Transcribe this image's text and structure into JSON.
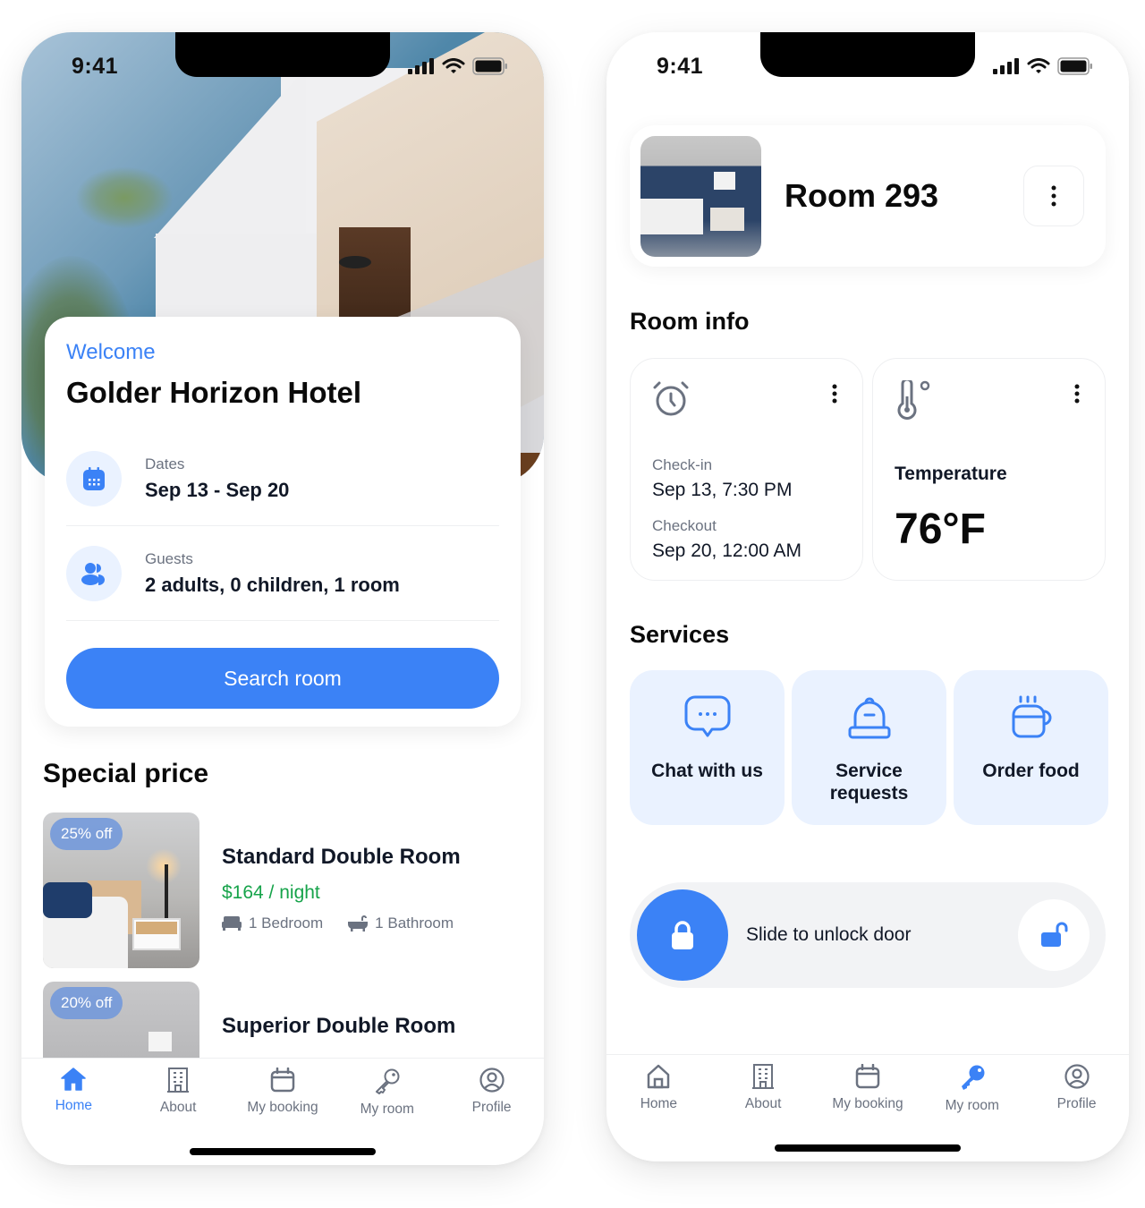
{
  "status_bar": {
    "time": "9:41"
  },
  "home_screen": {
    "welcome_label": "Welcome",
    "hotel_name": "Golder Horizon Hotel",
    "dates": {
      "label": "Dates",
      "value": "Sep 13 - Sep 20",
      "icon": "calendar-icon"
    },
    "guests": {
      "label": "Guests",
      "value": "2 adults, 0 children, 1 room",
      "icon": "users-icon"
    },
    "search_button": "Search room",
    "special_price_title": "Special price",
    "rooms": [
      {
        "badge": "25% off",
        "name": "Standard Double Room",
        "price": "$164 / night",
        "bedrooms": "1 Bedroom",
        "bathrooms": "1 Bathroom"
      },
      {
        "badge": "20% off",
        "name": "Superior Double Room"
      }
    ],
    "active_tab": "Home"
  },
  "room_screen": {
    "room_title": "Room 293",
    "room_info_title": "Room info",
    "checkin": {
      "label": "Check-in",
      "value": "Sep 13, 7:30 PM"
    },
    "checkout": {
      "label": "Checkout",
      "value": "Sep 20, 12:00 AM"
    },
    "temperature": {
      "label": "Temperature",
      "value": "76°F"
    },
    "services_title": "Services",
    "services": [
      {
        "label": "Chat with us",
        "icon": "chat-bubble-icon"
      },
      {
        "label": "Service requests",
        "icon": "service-bell-icon"
      },
      {
        "label": "Order food",
        "icon": "coffee-cup-icon"
      }
    ],
    "slider_text": "Slide to unlock door",
    "active_tab": "My room"
  },
  "tabs": [
    {
      "label": "Home",
      "icon": "home-icon"
    },
    {
      "label": "About",
      "icon": "building-icon"
    },
    {
      "label": "My booking",
      "icon": "calendar-icon"
    },
    {
      "label": "My room",
      "icon": "key-icon"
    },
    {
      "label": "Profile",
      "icon": "user-circle-icon"
    }
  ],
  "colors": {
    "accent": "#3b82f6",
    "price_green": "#16a34a",
    "light_blue_bg": "#eaf2ff",
    "muted_text": "#6b7280"
  }
}
